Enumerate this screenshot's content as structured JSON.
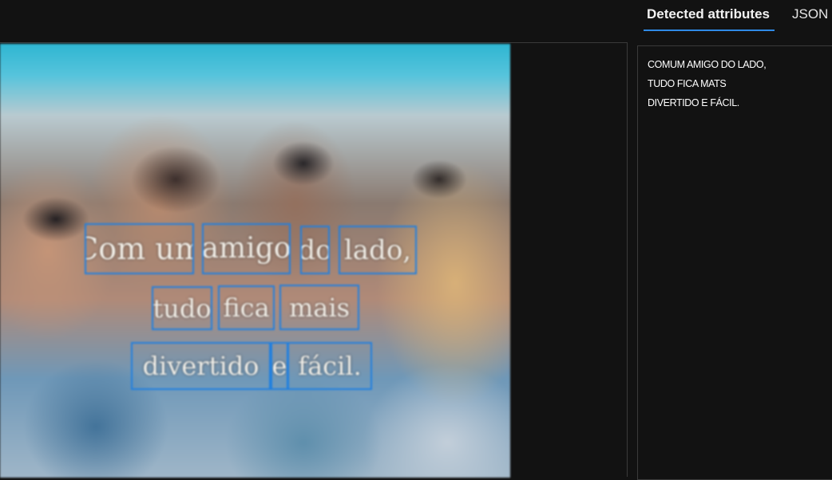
{
  "tabs": [
    {
      "label": "Detected attributes",
      "active": true
    },
    {
      "label": "JSON",
      "active": false
    }
  ],
  "image": {
    "description_icon": "photo",
    "ocr_words": [
      {
        "text": "Com um",
        "line": 1
      },
      {
        "text": "amigo",
        "line": 1
      },
      {
        "text": "do",
        "line": 1
      },
      {
        "text": "lado,",
        "line": 1
      },
      {
        "text": "tudo",
        "line": 2
      },
      {
        "text": "fica",
        "line": 2
      },
      {
        "text": "mais",
        "line": 2
      },
      {
        "text": "divertido",
        "line": 3
      },
      {
        "text": "e",
        "line": 3
      },
      {
        "text": "fácil.",
        "line": 3
      }
    ]
  },
  "result_lines": [
    "COMUM AMIGO DO LADO,",
    "TUDO FICA MATS",
    "DIVERTIDO E FÁCIL."
  ],
  "colors": {
    "accent": "#2f8ae6",
    "box": "#1f7fe0",
    "background": "#121212"
  }
}
